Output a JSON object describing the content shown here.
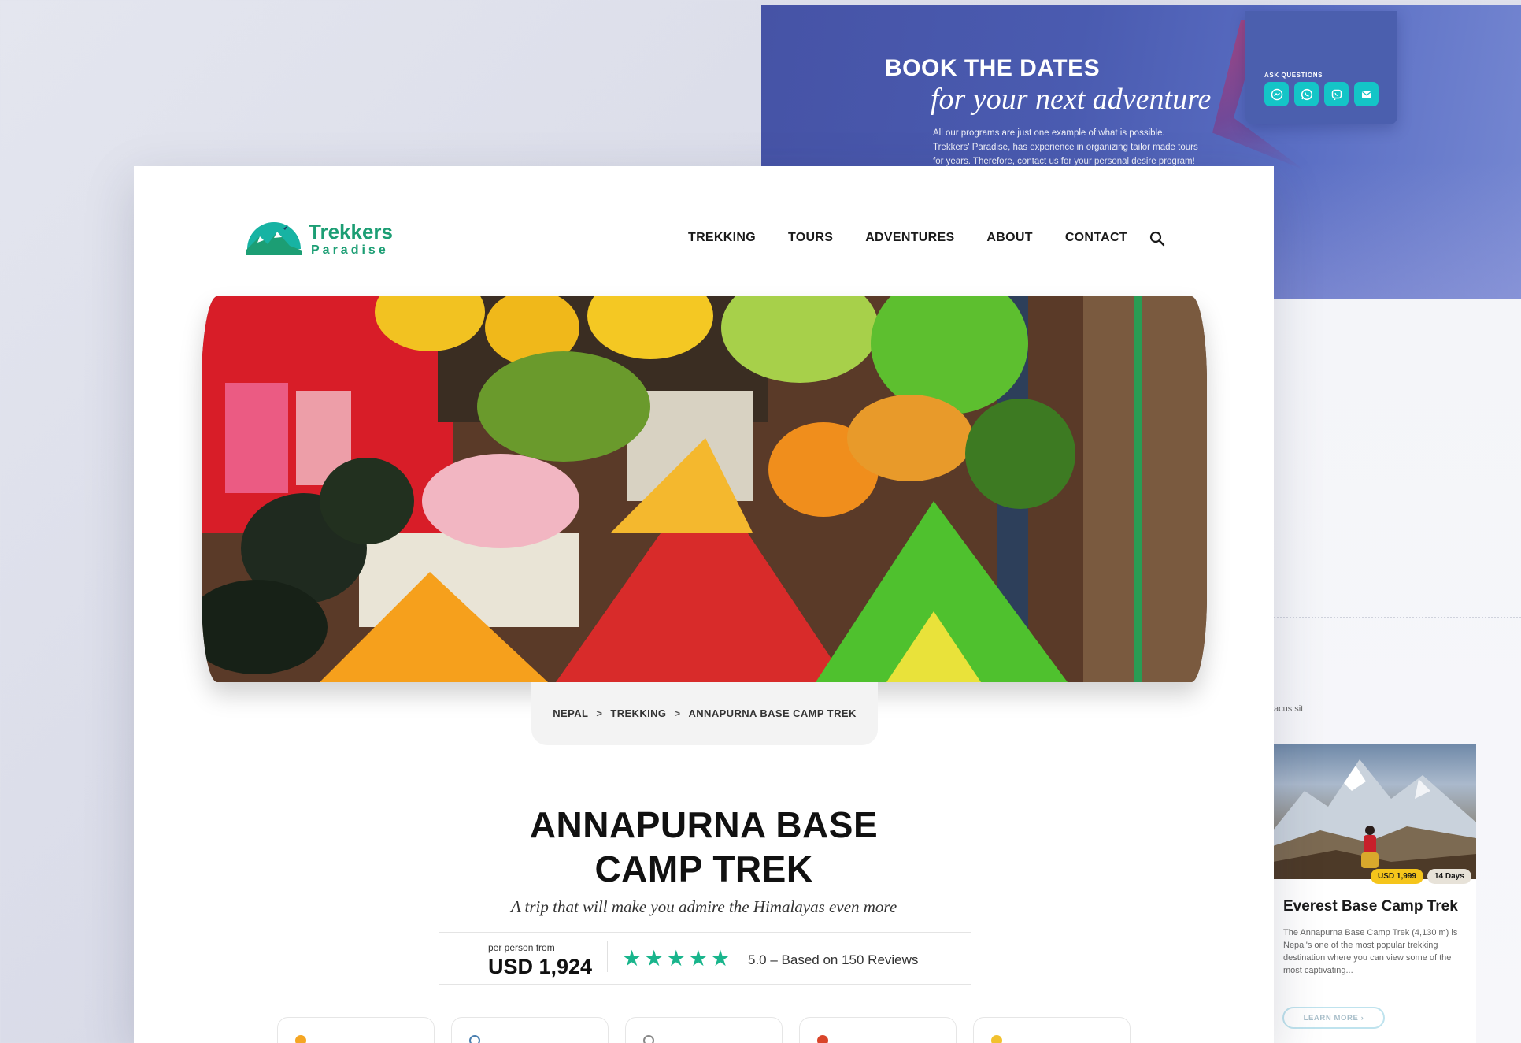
{
  "book": {
    "title": "BOOK THE DATES",
    "subtitle": "for your next adventure",
    "body_1": "All our programs are just one example of what is possible.",
    "body_2": "Trekkers' Paradise, has experience in organizing tailor made tours",
    "body_3a": "for years. Therefore, ",
    "body_link": "contact us",
    "body_3b": " for your personal desire program!",
    "ask_label": "ASK QUESTIONS",
    "ask_icons": [
      "messenger-icon",
      "whatsapp-icon",
      "viber-icon",
      "mail-icon"
    ]
  },
  "side": {
    "fragment": "acus sit",
    "card": {
      "price": "USD 1,999",
      "days": "14 Days",
      "title": "Everest Base Camp Trek",
      "description": "The Annapurna Base Camp Trek (4,130 m) is Nepal's one of the most popular trekking destination where you can view some of the most captivating...",
      "button": "LEARN MORE ›"
    }
  },
  "header": {
    "logo_line1": "Trekkers",
    "logo_line2": "Paradise",
    "nav": [
      "TREKKING",
      "TOURS",
      "ADVENTURES",
      "ABOUT",
      "CONTACT"
    ]
  },
  "breadcrumb": {
    "items": [
      "NEPAL",
      "TREKKING",
      "ANNAPURNA BASE CAMP TREK"
    ],
    "separator": ">"
  },
  "trip": {
    "title_line1": "ANNAPURNA BASE",
    "title_line2": "CAMP TREK",
    "tagline": "A trip that will make you admire the Himalayas even more",
    "price_label": "per person from",
    "price": "USD 1,924",
    "rating_stars": 5,
    "rating_text": "5.0 – Based on 150 Reviews"
  },
  "colors": {
    "brand_green": "#1c9e74",
    "star": "#19b58c",
    "book_bg": "#4653a6",
    "icon_teal": "#14c5c7",
    "price_badge": "#f5c51b"
  }
}
